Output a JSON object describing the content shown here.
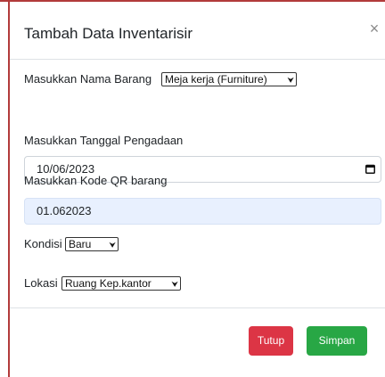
{
  "modal": {
    "title": "Tambah Data Inventarisir",
    "close_glyph": "×"
  },
  "form": {
    "nama_barang_label": "Masukkan Nama Barang",
    "nama_barang_value": "Meja kerja (Furniture)",
    "tanggal_label": "Masukkan Tanggal Pengadaan",
    "tanggal_value": "10/06/2023",
    "kode_qr_label": "Masukkan Kode QR barang",
    "kode_qr_value": "01.062023",
    "kondisi_label": "Kondisi",
    "kondisi_value": "Baru",
    "lokasi_label": "Lokasi",
    "lokasi_value": "Ruang Kep.kantor"
  },
  "footer": {
    "tutup_label": "Tutup",
    "simpan_label": "Simpan"
  },
  "icons": {
    "close": "close-icon",
    "calendar": "calendar-icon",
    "dropdown": "chevron-down-icon"
  },
  "colors": {
    "danger": "#dc3545",
    "success": "#28a745",
    "autofill_bg": "#e8f0fe"
  }
}
